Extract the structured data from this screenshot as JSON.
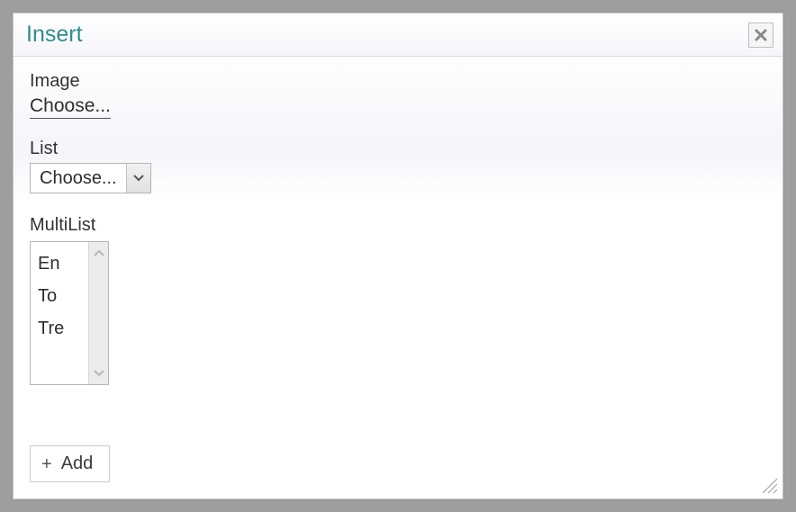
{
  "dialog": {
    "title": "Insert"
  },
  "fields": {
    "image": {
      "label": "Image",
      "choose_text": "Choose..."
    },
    "list": {
      "label": "List",
      "selected": "Choose..."
    },
    "multilist": {
      "label": "MultiList",
      "items": [
        "En",
        "To",
        "Tre"
      ]
    }
  },
  "buttons": {
    "add_label": "Add"
  }
}
